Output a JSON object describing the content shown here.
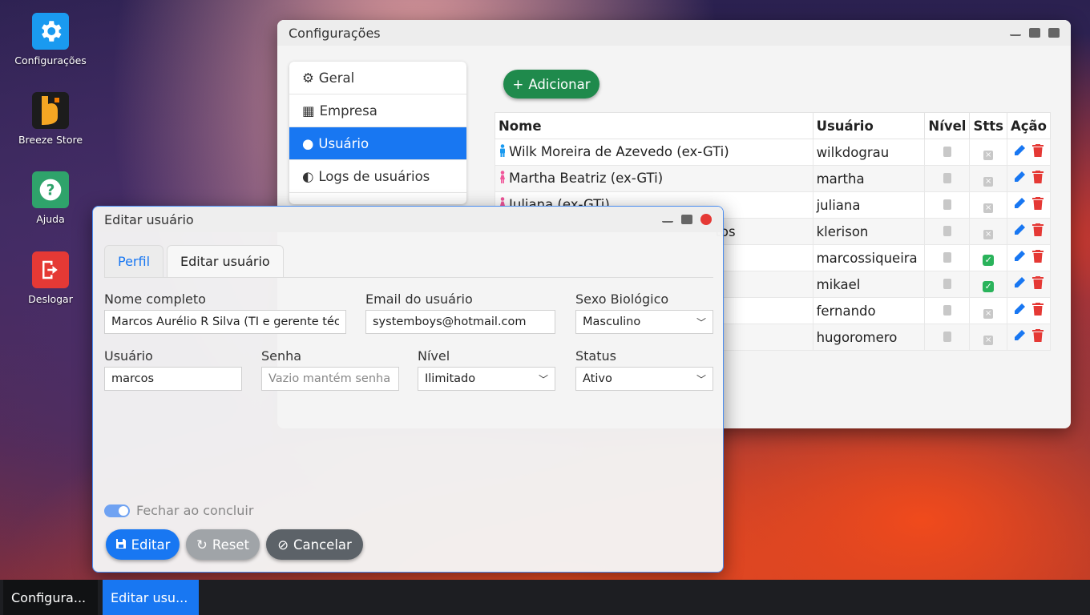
{
  "desktop": {
    "icons": [
      {
        "label": "Configurações",
        "color": "#1a9af0"
      },
      {
        "label": "Breeze Store",
        "color": "#1c1c1c"
      },
      {
        "label": "Ajuda",
        "color": "#2fa36b"
      },
      {
        "label": "Deslogar",
        "color": "#e53935"
      }
    ]
  },
  "config_window": {
    "title": "Configurações",
    "sidebar": [
      {
        "label": "Geral"
      },
      {
        "label": "Empresa"
      },
      {
        "label": "Usuário"
      },
      {
        "label": "Logs de usuários"
      }
    ],
    "add_button": "Adicionar",
    "table": {
      "headers": [
        "Nome",
        "Usuário",
        "Nível",
        "Stts",
        "Ação"
      ],
      "rows": [
        {
          "name": "Wilk Moreira de Azevedo (ex-GTi)",
          "user": "wilkdograu",
          "active": false,
          "gender": "male"
        },
        {
          "name": "Martha Beatriz (ex-GTi)",
          "user": "martha",
          "active": false,
          "gender": "female"
        },
        {
          "name": "Juliana (ex-GTi)",
          "user": "juliana",
          "active": false,
          "gender": "female"
        },
        {
          "name": "",
          "user": "klerison",
          "active": false,
          "gender": ""
        },
        {
          "name": "",
          "user": "marcossiqueira",
          "active": true,
          "gender": ""
        },
        {
          "name": "",
          "user": "mikael",
          "active": true,
          "gender": ""
        },
        {
          "name": "",
          "user": "fernando",
          "active": false,
          "gender": ""
        },
        {
          "name": "",
          "user": "hugoromero",
          "active": false,
          "gender": ""
        }
      ],
      "name_fragment": "tos"
    }
  },
  "edit_window": {
    "title": "Editar usuário",
    "tabs": [
      "Perfil",
      "Editar usuário"
    ],
    "fields": {
      "nome_label": "Nome completo",
      "nome_value": "Marcos Aurélio R Silva (TI e gerente técnico)",
      "email_label": "Email do usuário",
      "email_value": "systemboys@hotmail.com",
      "sexo_label": "Sexo Biológico",
      "sexo_value": "Masculino",
      "usuario_label": "Usuário",
      "usuario_value": "marcos",
      "senha_label": "Senha",
      "senha_placeholder": "Vazio mantém senha",
      "nivel_label": "Nível",
      "nivel_value": "Ilimitado",
      "status_label": "Status",
      "status_value": "Ativo"
    },
    "close_toggle_label": "Fechar ao concluir",
    "buttons": {
      "edit": "Editar",
      "reset": "Reset",
      "cancel": "Cancelar"
    }
  },
  "taskbar": {
    "items": [
      "Configura...",
      "Editar usu..."
    ]
  }
}
